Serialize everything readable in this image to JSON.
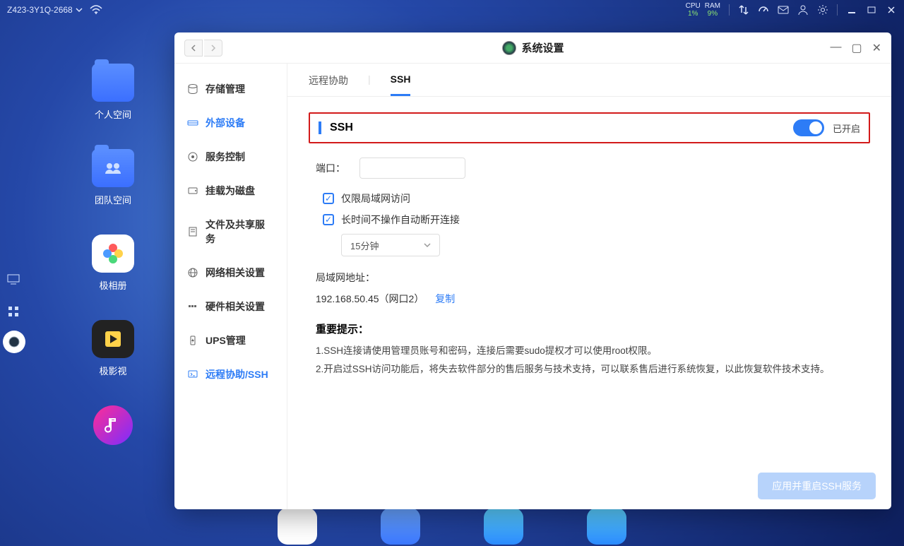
{
  "topbar": {
    "device_name": "Z423-3Y1Q-2668",
    "cpu_label": "CPU",
    "cpu_value": "1%",
    "ram_label": "RAM",
    "ram_value": "9%"
  },
  "desktop": {
    "items": [
      {
        "label": "个人空间"
      },
      {
        "label": "团队空间"
      },
      {
        "label": "极相册"
      },
      {
        "label": "极影视"
      }
    ]
  },
  "window": {
    "title": "系统设置",
    "sidebar": [
      {
        "label": "存储管理",
        "icon": "storage-icon"
      },
      {
        "label": "外部设备",
        "icon": "external-device-icon",
        "active": true
      },
      {
        "label": "服务控制",
        "icon": "service-control-icon"
      },
      {
        "label": "挂载为磁盘",
        "icon": "mount-disk-icon"
      },
      {
        "label": "文件及共享服务",
        "icon": "file-share-icon"
      },
      {
        "label": "网络相关设置",
        "icon": "network-icon"
      },
      {
        "label": "硬件相关设置",
        "icon": "hardware-icon"
      },
      {
        "label": "UPS管理",
        "icon": "ups-icon"
      },
      {
        "label": "远程协助/SSH",
        "icon": "remote-ssh-icon",
        "active": true
      }
    ],
    "tabs": {
      "remote": "远程协助",
      "ssh": "SSH"
    },
    "ssh_panel": {
      "header": "SSH",
      "toggle_state": "已开启",
      "port_label": "端口：",
      "checkbox_lan": "仅限局域网访问",
      "checkbox_idle": "长时间不操作自动断开连接",
      "timeout_value": "15分钟",
      "lan_addr_label": "局域网地址：",
      "lan_addr_value": "192.168.50.45（网口2）",
      "copy_label": "复制",
      "notice_title": "重要提示：",
      "notice_1": "1.SSH连接请使用管理员账号和密码，连接后需要sudo提权才可以使用root权限。",
      "notice_2": "2.开启过SSH访问功能后，将失去软件部分的售后服务与技术支持，可以联系售后进行系统恢复，以此恢复软件技术支持。",
      "apply_button": "应用并重启SSH服务"
    }
  }
}
